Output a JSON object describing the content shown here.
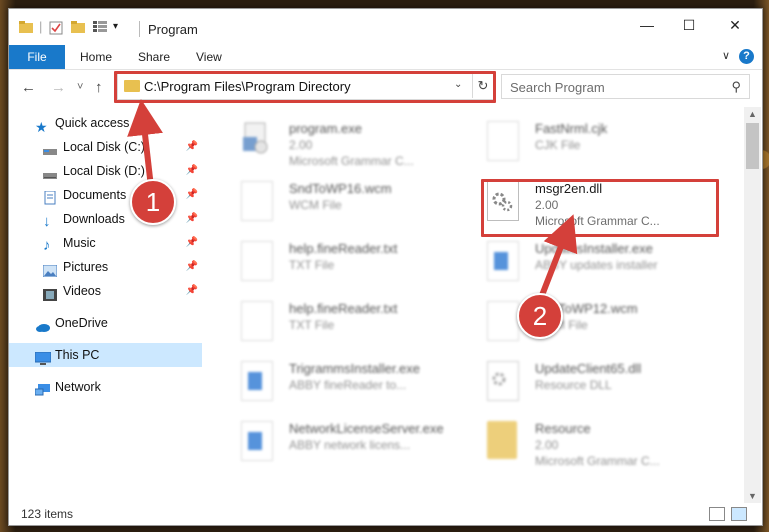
{
  "window": {
    "title": "Program",
    "controls": {
      "minimize": "—",
      "maximize": "☐",
      "close": "✕"
    }
  },
  "ribbon": {
    "tabs": [
      "File",
      "Home",
      "Share",
      "View"
    ],
    "help": "?"
  },
  "nav": {
    "back": "←",
    "forward": "→",
    "recent": "˅",
    "up": "↑",
    "address": "C:\\Program Files\\Program Directory",
    "search_placeholder": "Search Program"
  },
  "sidebar": {
    "items": [
      {
        "label": "Quick access",
        "icon": "star-icon",
        "pinned": false
      },
      {
        "label": "Local Disk (C:)",
        "icon": "drive-icon",
        "pinned": true
      },
      {
        "label": "Local Disk (D:)",
        "icon": "drive-icon",
        "pinned": true
      },
      {
        "label": "Documents",
        "icon": "documents-icon",
        "pinned": true
      },
      {
        "label": "Downloads",
        "icon": "download-icon",
        "pinned": true
      },
      {
        "label": "Music",
        "icon": "music-icon",
        "pinned": true
      },
      {
        "label": "Pictures",
        "icon": "pictures-icon",
        "pinned": true
      },
      {
        "label": "Videos",
        "icon": "videos-icon",
        "pinned": true
      },
      {
        "label": "OneDrive",
        "icon": "cloud-icon",
        "pinned": false
      },
      {
        "label": "This PC",
        "icon": "computer-icon",
        "pinned": false
      },
      {
        "label": "Network",
        "icon": "network-icon",
        "pinned": false
      }
    ]
  },
  "files": {
    "left": [
      {
        "name": "program.exe",
        "line2": "2.00",
        "line3": "Microsoft Grammar C...",
        "icon": "setup-icon"
      },
      {
        "name": "SndToWP16.wcm",
        "line2": "WCM File",
        "line3": "",
        "icon": "document-icon"
      },
      {
        "name": "help.fineReader.txt",
        "line2": "TXT File",
        "line3": "",
        "icon": "document-icon"
      },
      {
        "name": "help.fineReader.txt",
        "line2": "TXT File",
        "line3": "",
        "icon": "document-icon"
      },
      {
        "name": "TrigrammsInstaller.exe",
        "line2": "ABBY fineReader to...",
        "line3": "",
        "icon": "exe-icon"
      },
      {
        "name": "NetworkLicenseServer.exe",
        "line2": "ABBY network licens...",
        "line3": "",
        "icon": "exe-icon"
      }
    ],
    "right": [
      {
        "name": "FastNrml.cjk",
        "line2": "CJK File",
        "line3": "",
        "icon": "document-icon"
      },
      {
        "name": "msgr2en.dll",
        "line2": "2.00",
        "line3": "Microsoft Grammar C...",
        "icon": "dll-gear-icon"
      },
      {
        "name": "UpdatesInstaller.exe",
        "line2": "ABBY updates installer",
        "line3": "",
        "icon": "exe-icon"
      },
      {
        "name": "SndToWP12.wcm",
        "line2": "WCM File",
        "line3": "",
        "icon": "document-icon"
      },
      {
        "name": "UpdateClient65.dll",
        "line2": "Resource DLL",
        "line3": "",
        "icon": "dll-gear-icon"
      },
      {
        "name": "Resource",
        "line2": "2.00",
        "line3": "Microsoft Grammar C...",
        "icon": "folder-icon"
      }
    ]
  },
  "status": {
    "count": "123 items"
  },
  "callouts": {
    "one": "1",
    "two": "2"
  },
  "colors": {
    "accent": "#1979ca",
    "highlight": "#d4403a",
    "selected": "#cce8ff"
  }
}
